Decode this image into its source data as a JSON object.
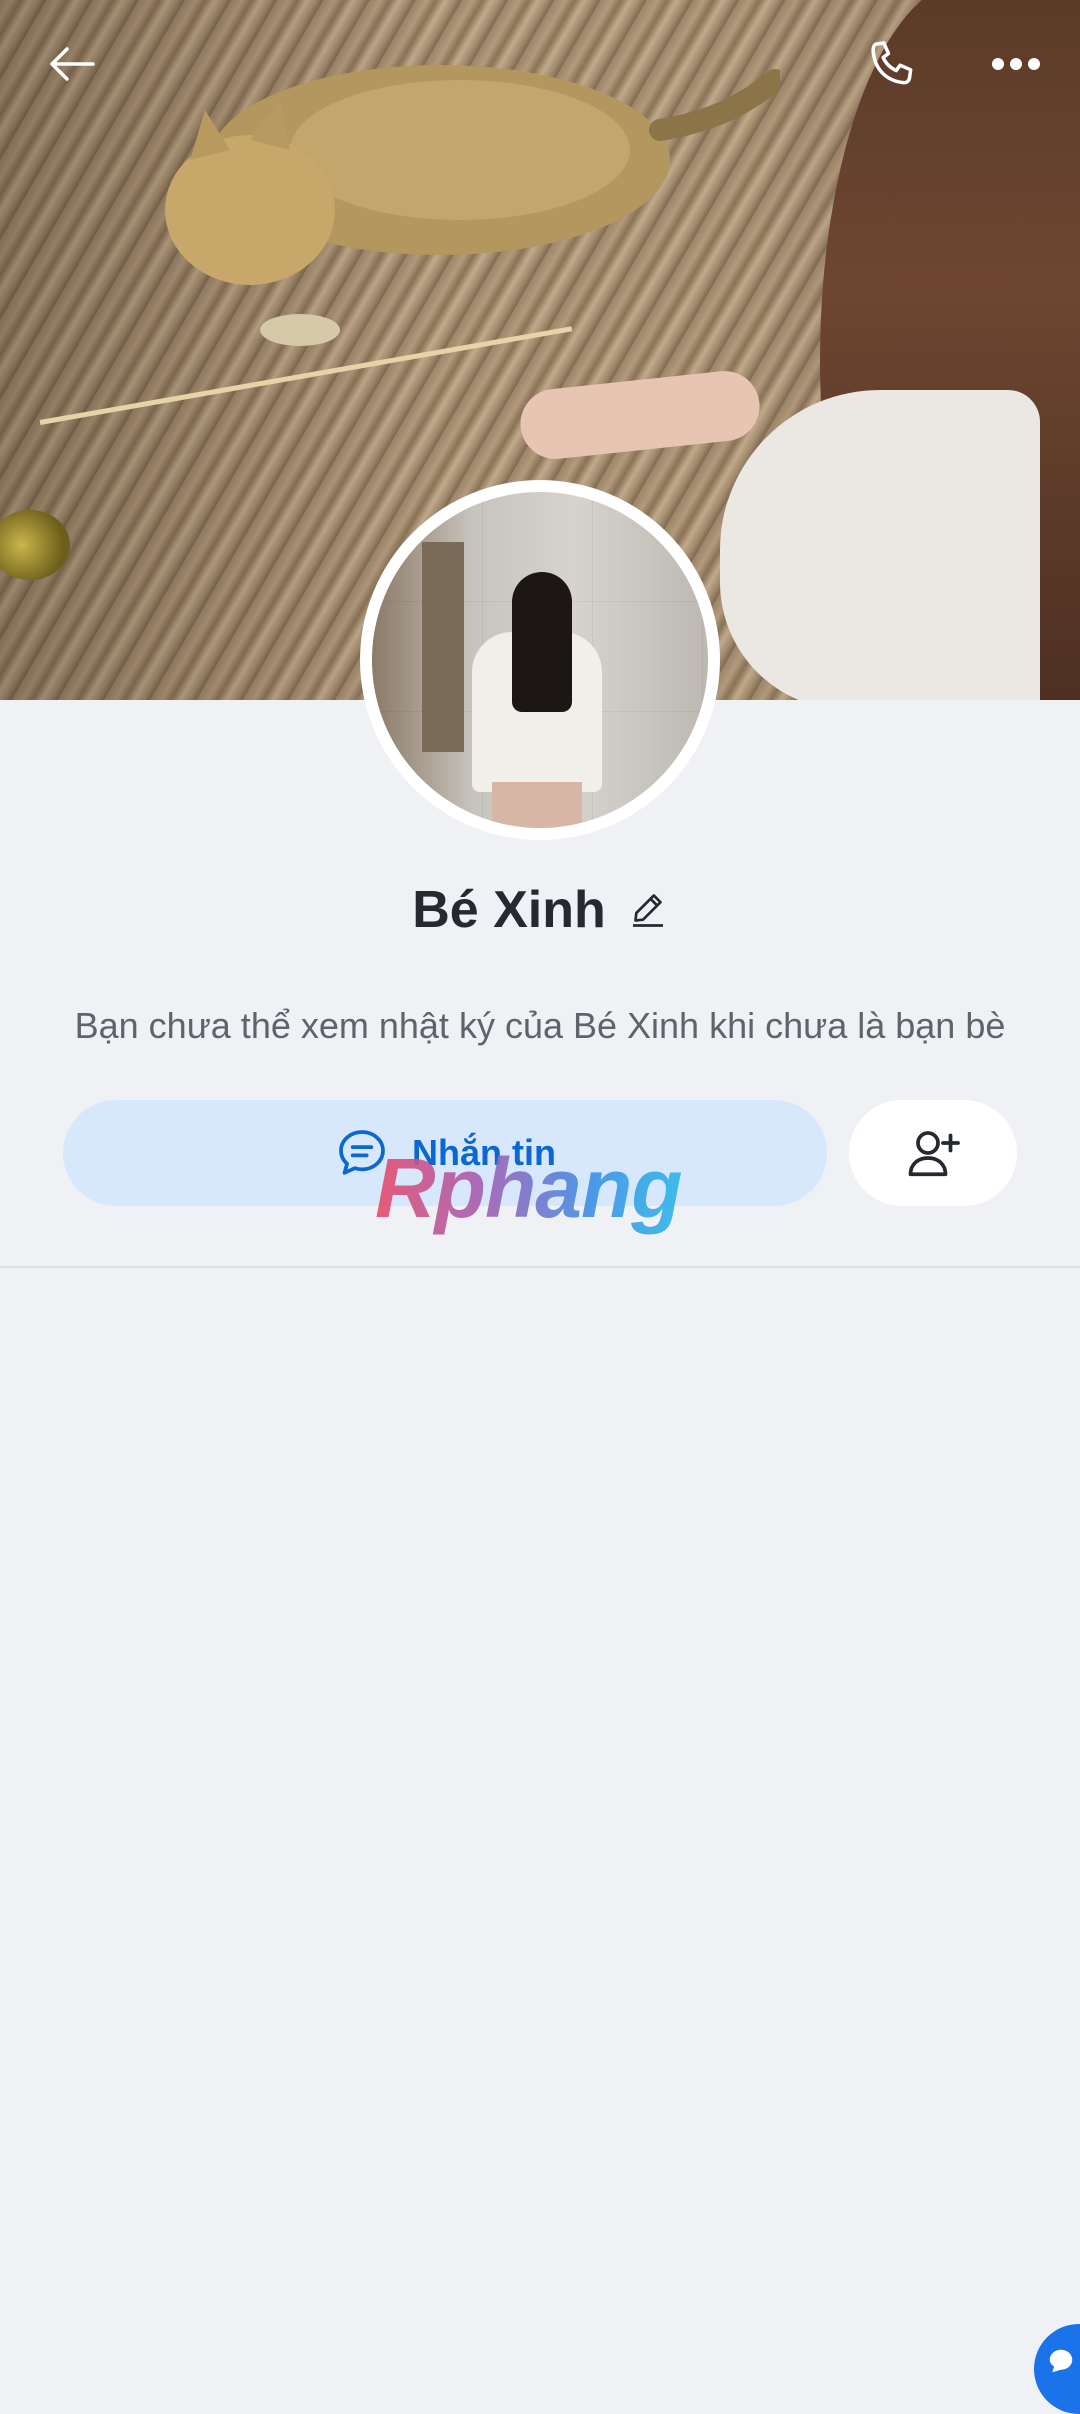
{
  "header": {
    "back_icon": "arrow-left-icon",
    "call_icon": "phone-icon",
    "more_icon": "more-horizontal-icon"
  },
  "profile": {
    "name": "Bé Xinh",
    "edit_icon": "pencil-icon",
    "notice": "Bạn chưa thể xem nhật ký của Bé Xinh khi chưa là bạn bè"
  },
  "actions": {
    "message_label": "Nhắn tin",
    "message_icon": "chat-bubble-icon",
    "add_friend_icon": "add-user-icon"
  },
  "watermark": {
    "text": "Rphang"
  },
  "fab": {
    "icon": "chat-icon"
  },
  "colors": {
    "accent": "#0a68d0",
    "message_button_bg": "#d7e7fc",
    "page_bg": "#f0f1f5"
  }
}
